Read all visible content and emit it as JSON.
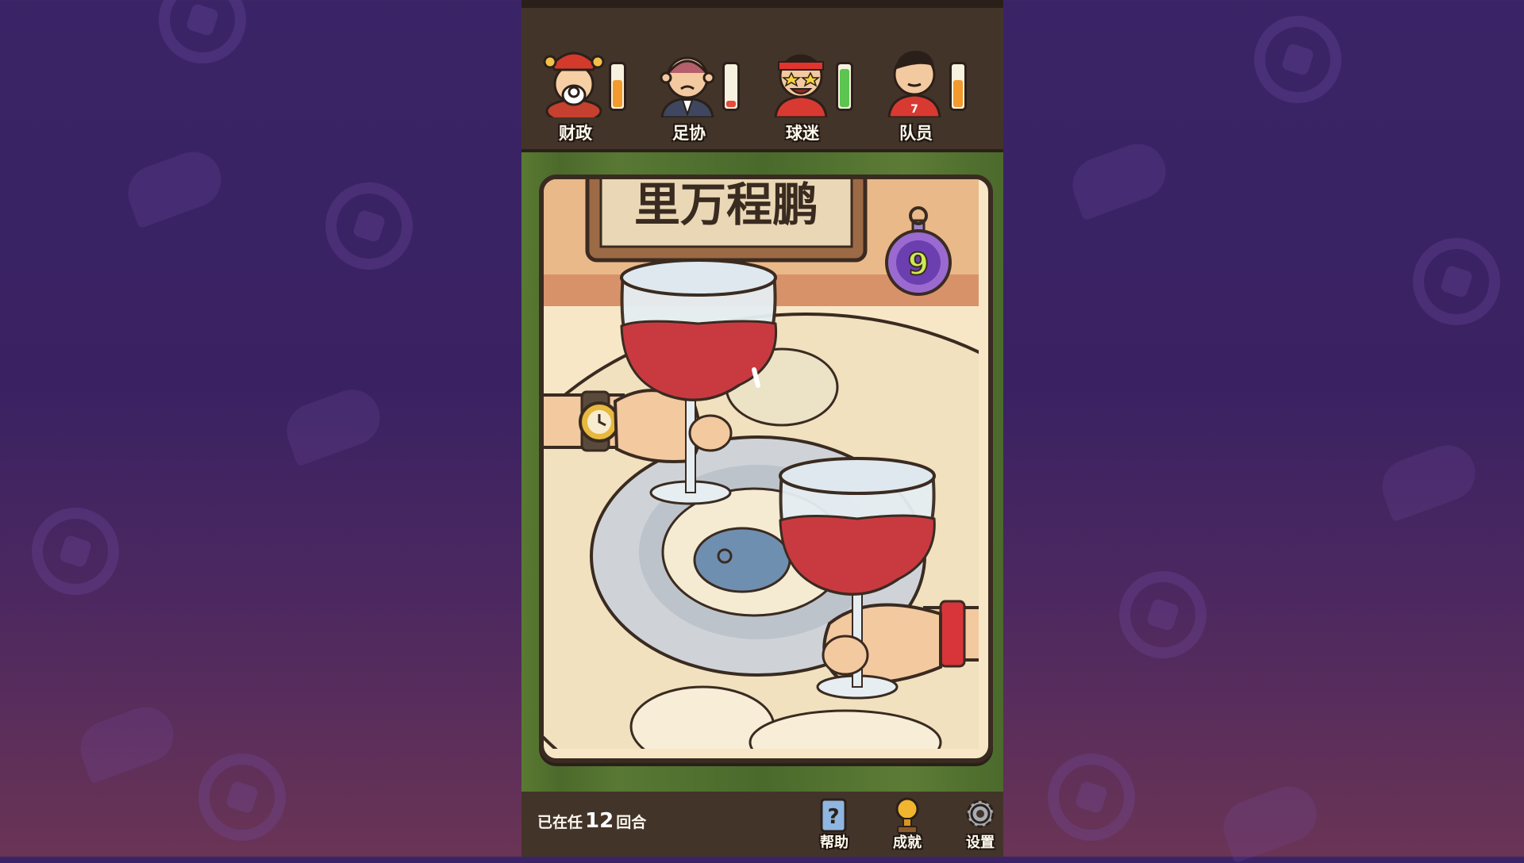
{
  "stats": [
    {
      "label": "财政",
      "level": 0.6,
      "color": "#f29a2e"
    },
    {
      "label": "足协",
      "level": 0.15,
      "color": "#e64b3c"
    },
    {
      "label": "球迷",
      "level": 0.85,
      "color": "#5cc451"
    },
    {
      "label": "队员",
      "level": 0.6,
      "color": "#f29a2e"
    }
  ],
  "scene": {
    "sign_text": "里万程鹏",
    "timer_value": "9"
  },
  "footer": {
    "rounds_prefix": "已在任",
    "rounds_count": "12",
    "rounds_suffix": "回合",
    "help_label": "帮助",
    "achievements_label": "成就",
    "settings_label": "设置"
  },
  "icons": {
    "help": "question-book-icon",
    "achievements": "trophy-icon",
    "settings": "gear-icon"
  }
}
